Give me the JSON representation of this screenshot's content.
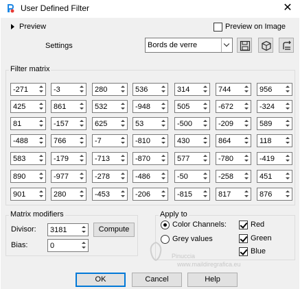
{
  "window": {
    "title": "User Defined Filter",
    "close_glyph": "✕"
  },
  "preview": {
    "toggle_label": "Preview",
    "preview_on_image_label": "Preview on Image",
    "preview_on_image_checked": false
  },
  "settings": {
    "label": "Settings",
    "preset_value": "Bords de verre"
  },
  "filter_matrix": {
    "title": "Filter matrix",
    "rows": [
      [
        "-271",
        "-3",
        "280",
        "536",
        "314",
        "744",
        "956"
      ],
      [
        "425",
        "861",
        "532",
        "-948",
        "505",
        "-672",
        "-324"
      ],
      [
        "81",
        "-157",
        "625",
        "53",
        "-500",
        "-209",
        "589"
      ],
      [
        "-488",
        "766",
        "-7",
        "-810",
        "430",
        "864",
        "118"
      ],
      [
        "583",
        "-179",
        "-713",
        "-870",
        "577",
        "-780",
        "-419"
      ],
      [
        "890",
        "-977",
        "-278",
        "-486",
        "-50",
        "-258",
        "451"
      ],
      [
        "901",
        "280",
        "-453",
        "-206",
        "-815",
        "817",
        "876"
      ]
    ]
  },
  "matrix_modifiers": {
    "title": "Matrix modifiers",
    "divisor_label": "Divisor:",
    "divisor_value": "3181",
    "compute_label": "Compute",
    "bias_label": "Bias:",
    "bias_value": "0"
  },
  "apply_to": {
    "title": "Apply to",
    "color_channels_label": "Color Channels:",
    "grey_values_label": "Grey values",
    "selected": "color_channels",
    "red_label": "Red",
    "green_label": "Green",
    "blue_label": "Blue",
    "red_checked": true,
    "green_checked": true,
    "blue_checked": true
  },
  "watermark": {
    "line1": "Pinuccia",
    "line2": "www.maildiregrafica.eu"
  },
  "footer": {
    "ok_label": "OK",
    "cancel_label": "Cancel",
    "help_label": "Help"
  },
  "colors": {
    "accent": "#0078d7",
    "dialog_bg": "#f0f0f0",
    "button_bg": "#e1e1e1"
  }
}
